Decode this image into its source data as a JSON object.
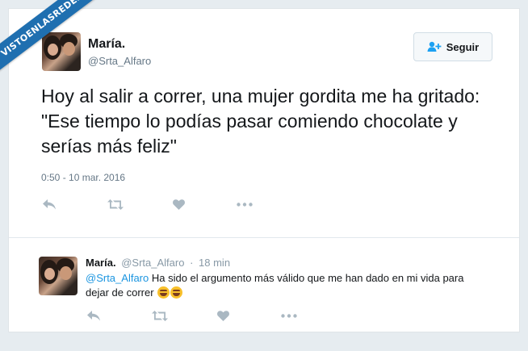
{
  "watermark": "VISTOENLASREDES",
  "tweet": {
    "author_name": "María.",
    "author_handle": "@Srta_Alfaro",
    "follow_label": "Seguir",
    "text": "Hoy al salir a correr, una mujer gordita me ha gritado: \"Ese tiempo lo podías pasar comiendo chocolate y serías más feliz\"",
    "timestamp": "0:50 - 10 mar. 2016",
    "actions": [
      "reply-icon",
      "retweet-icon",
      "heart-icon",
      "more-icon"
    ]
  },
  "reply": {
    "author_name": "María.",
    "author_handle": "@Srta_Alfaro",
    "separator": "·",
    "time": "18 min",
    "mention": "@Srta_Alfaro",
    "text": "Ha sido el argumento más válido que me han dado en mi vida para dejar de correr",
    "emojis": [
      "face-with-tears-of-joy",
      "face-with-tears-of-joy"
    ],
    "actions": [
      "reply-icon",
      "retweet-icon",
      "heart-icon",
      "more-icon"
    ]
  },
  "colors": {
    "background": "#e6ecf0",
    "card": "#ffffff",
    "link": "#1b95e0",
    "muted": "#657786",
    "icon": "#aab8c2",
    "watermark": "#1f6fb0"
  }
}
